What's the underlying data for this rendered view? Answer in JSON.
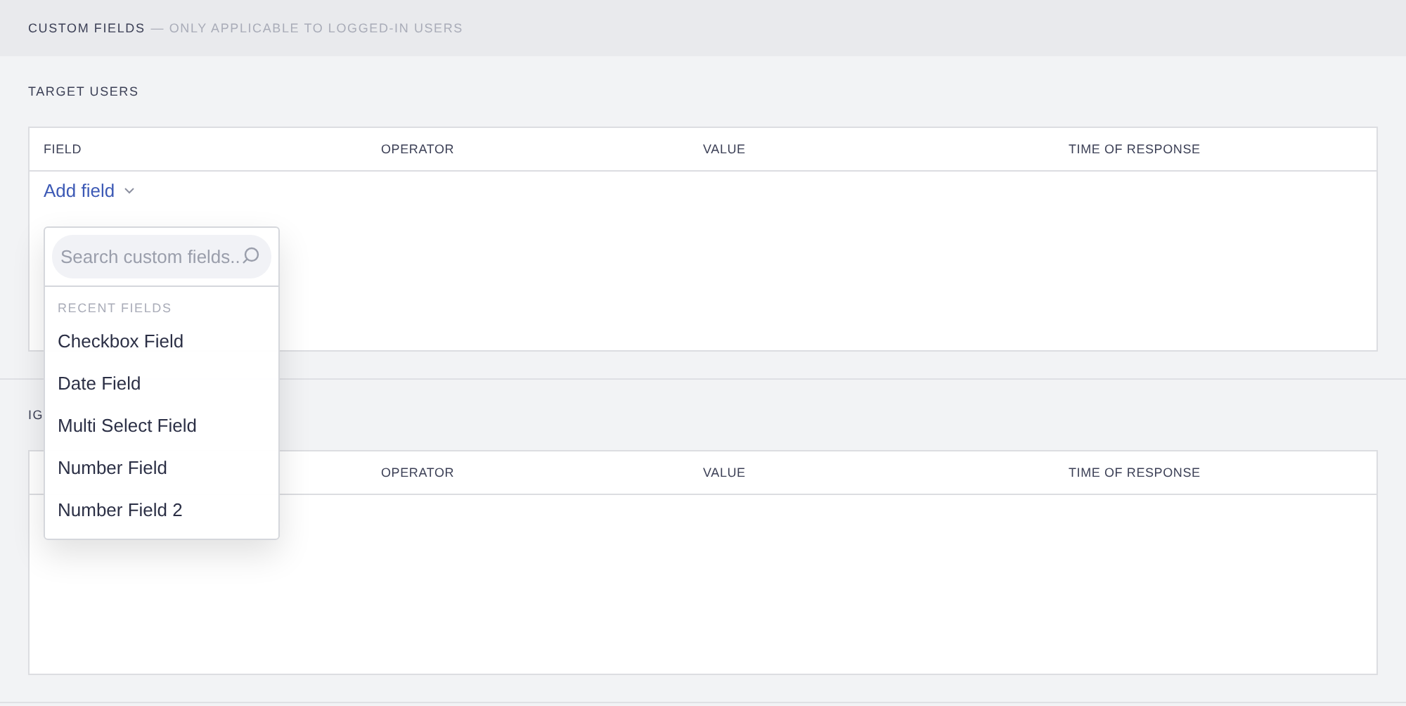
{
  "header": {
    "title": "CUSTOM FIELDS",
    "subtitle": "— ONLY APPLICABLE TO LOGGED-IN USERS"
  },
  "sections": [
    {
      "title": "TARGET USERS",
      "table": {
        "columns": [
          "FIELD",
          "OPERATOR",
          "VALUE",
          "TIME OF RESPONSE"
        ]
      },
      "add_link": "Add field"
    },
    {
      "title": "IG",
      "table": {
        "columns": [
          "OPERATOR",
          "VALUE",
          "TIME OF RESPONSE"
        ]
      }
    }
  ],
  "dropdown": {
    "search": {
      "placeholder": "Search custom fields..."
    },
    "group_label": "RECENT FIELDS",
    "items": [
      "Checkbox Field",
      "Date Field",
      "Multi Select Field",
      "Number Field",
      "Number Field 2"
    ]
  }
}
